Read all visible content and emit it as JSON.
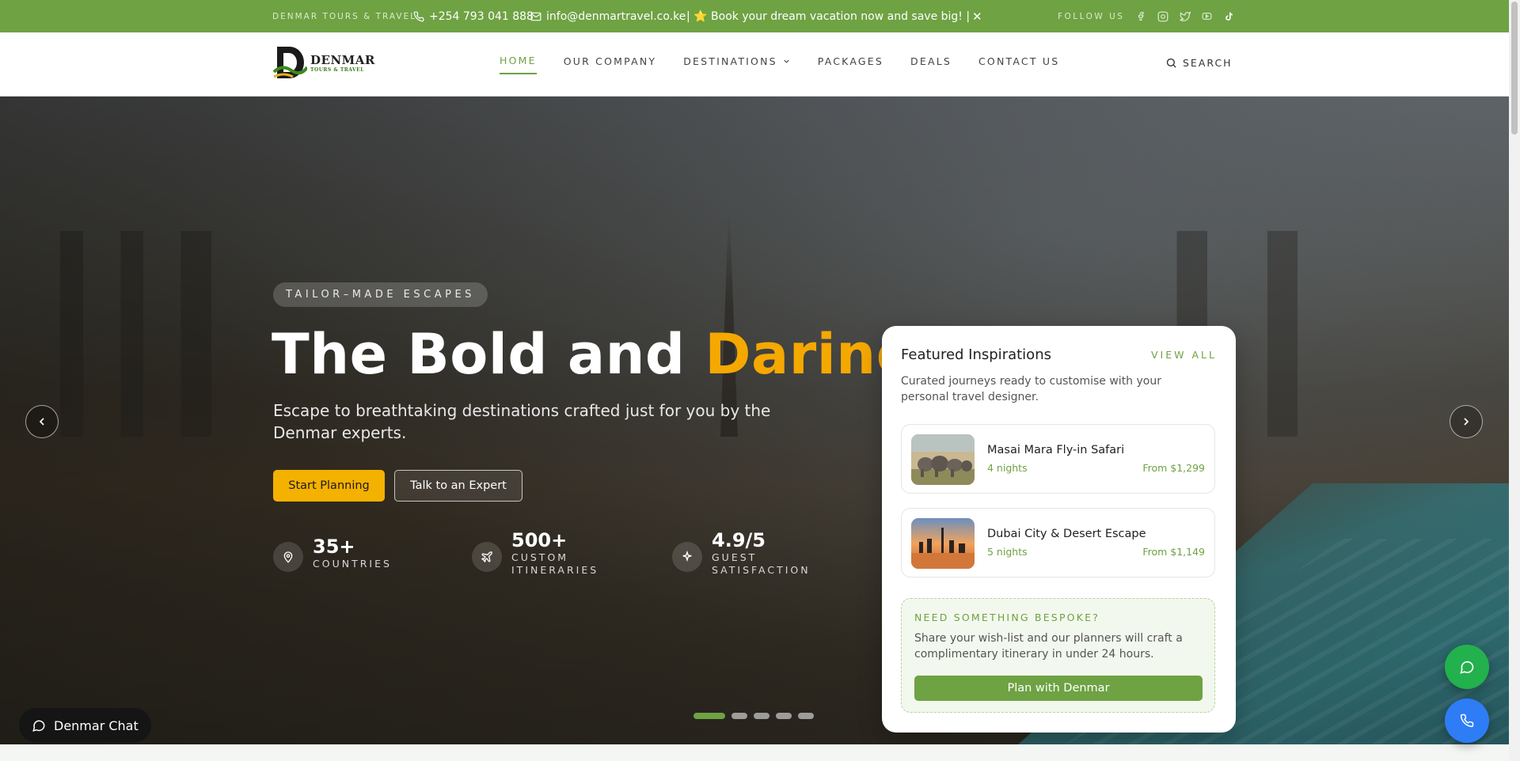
{
  "topbar": {
    "brand": "DENMAR TOURS & TRAVEL",
    "phone": "+254 793 041 888",
    "email": "info@denmartravel.co.ke",
    "promo": "| ⭐ Book your dream vacation now and save big! |",
    "close": "✕",
    "follow": "FOLLOW US",
    "socials": [
      "facebook-icon",
      "instagram-icon",
      "twitter-icon",
      "youtube-icon",
      "tiktok-icon"
    ]
  },
  "logo": {
    "name": "DENMAR",
    "tagline": "TOURS & TRAVEL"
  },
  "nav": {
    "items": [
      "HOME",
      "OUR COMPANY",
      "DESTINATIONS",
      "PACKAGES",
      "DEALS",
      "CONTACT US"
    ],
    "active": "HOME",
    "search": "SEARCH"
  },
  "hero": {
    "eyebrow": "TAILOR–MADE ESCAPES",
    "headline_main": "The Bold and ",
    "headline_accent": "Daring",
    "subtext": "Escape to breathtaking destinations crafted just for you by the Denmar experts.",
    "primary_button": "Start Planning",
    "secondary_button": "Talk to an Expert",
    "stats": [
      {
        "value": "35+",
        "label": "COUNTRIES",
        "icon": "location-pin-icon"
      },
      {
        "value": "500+",
        "label": "CUSTOM ITINERARIES",
        "icon": "plane-icon"
      },
      {
        "value": "4.9/5",
        "label": "GUEST SATISFACTION",
        "icon": "sparkle-icon"
      }
    ],
    "slides": 5,
    "active_slide": 1
  },
  "featured": {
    "title": "Featured Inspirations",
    "view_all": "VIEW ALL",
    "description": "Curated journeys ready to customise with your personal travel designer.",
    "trips": [
      {
        "name": "Masai Mara Fly-in Safari",
        "meta": "4 nights",
        "price": "From $1,299"
      },
      {
        "name": "Dubai City & Desert Escape",
        "meta": "5 nights",
        "price": "From $1,149"
      }
    ],
    "bespoke": {
      "heading": "NEED SOMETHING BESPOKE?",
      "text": "Share your wish-list and our planners will craft a complimentary itinerary in under 24 hours.",
      "button": "Plan with Denmar"
    }
  },
  "chat": {
    "label": "Denmar Chat"
  },
  "colors": {
    "brand_green": "#6ea243",
    "accent_gold": "#f5a800",
    "whatsapp": "#22b14c",
    "call": "#2e7cf6"
  }
}
